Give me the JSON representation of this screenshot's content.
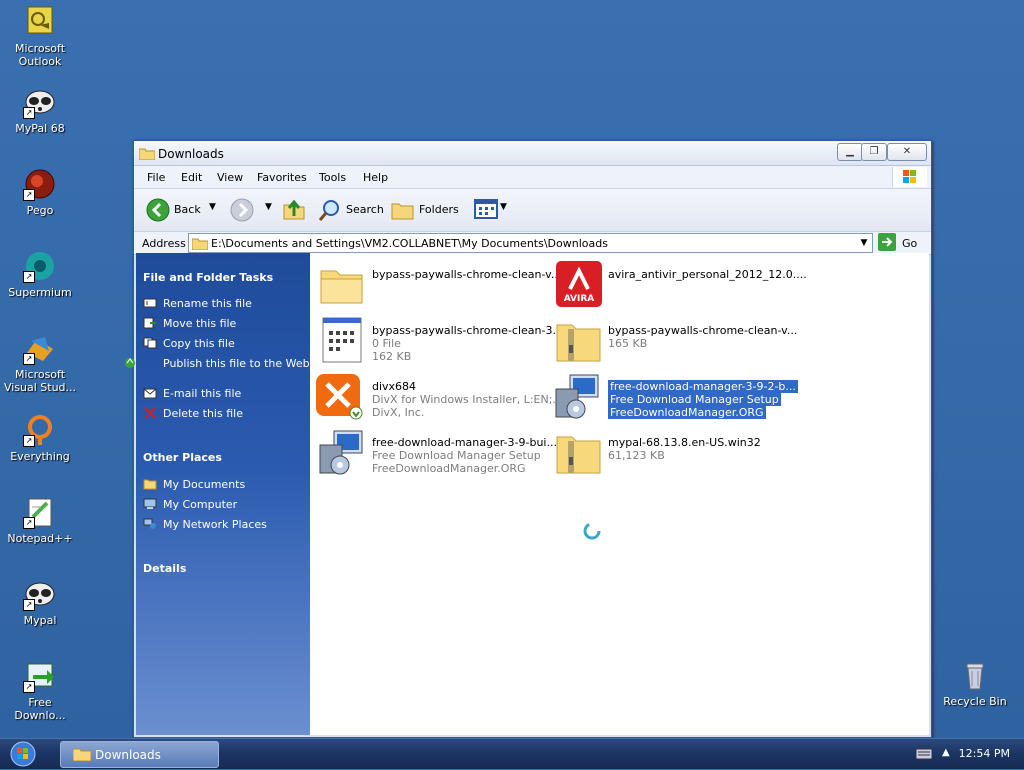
{
  "desktop": {
    "icons": [
      {
        "label": "Microsoft Outlook"
      },
      {
        "label": "MyPal 68"
      },
      {
        "label": "Pego"
      },
      {
        "label": "Supermium"
      },
      {
        "label": "Microsoft Visual Stud..."
      },
      {
        "label": "Everything"
      },
      {
        "label": "Notepad++"
      },
      {
        "label": "Mypal"
      },
      {
        "label": "Free Downlo..."
      },
      {
        "label": "Recycle Bin"
      }
    ]
  },
  "window": {
    "title": "Downloads",
    "menu": [
      "File",
      "Edit",
      "View",
      "Favorites",
      "Tools",
      "Help"
    ],
    "toolbar": {
      "back": "Back",
      "search": "Search",
      "folders": "Folders"
    },
    "address": {
      "label": "Address",
      "value": "E:\\Documents and Settings\\VM2.COLLABNET\\My Documents\\Downloads",
      "go": "Go"
    },
    "taskpane": {
      "file_tasks": {
        "title": "File and Folder Tasks",
        "items": [
          "Rename this file",
          "Move this file",
          "Copy this file",
          "Publish this file to the Web",
          "E-mail this file",
          "Delete this file"
        ]
      },
      "other_places": {
        "title": "Other Places",
        "items": [
          "My Documents",
          "My Computer",
          "My Network Places"
        ]
      },
      "details": {
        "title": "Details"
      }
    },
    "files": [
      {
        "name": "bypass-paywalls-chrome-clean-v...",
        "line2": "",
        "line3": "",
        "icon": "folder-icon"
      },
      {
        "name": "avira_antivir_personal_2012_12.0....",
        "line2": "",
        "line3": "",
        "icon": "avira-icon"
      },
      {
        "name": "bypass-paywalls-chrome-clean-3....",
        "line2": "0 File",
        "line3": "162 KB",
        "icon": "file-list-icon"
      },
      {
        "name": "bypass-paywalls-chrome-clean-v...",
        "line2": "165 KB",
        "line3": "",
        "icon": "zip-folder-icon"
      },
      {
        "name": "divx684",
        "line2": "DivX for Windows Installer, L:EN;...",
        "line3": "DivX, Inc.",
        "icon": "divx-icon"
      },
      {
        "name": "free-download-manager-3-9-2-b...",
        "line2": "Free Download Manager Setup",
        "line3": "FreeDownloadManager.ORG",
        "icon": "installer-icon"
      },
      {
        "name": "free-download-manager-3-9-bui...",
        "line2": "Free Download Manager Setup",
        "line3": "FreeDownloadManager.ORG",
        "icon": "installer-icon"
      },
      {
        "name": "mypal-68.13.8.en-US.win32",
        "line2": "61,123 KB",
        "line3": "",
        "icon": "zip-folder-icon"
      }
    ]
  },
  "taskbar": {
    "button_label": "Downloads",
    "clock": "12:54 PM"
  },
  "colors": {
    "selection": "#3169c6",
    "desktop": "#3a6ea5",
    "taskpane": "#2b5bb0"
  }
}
